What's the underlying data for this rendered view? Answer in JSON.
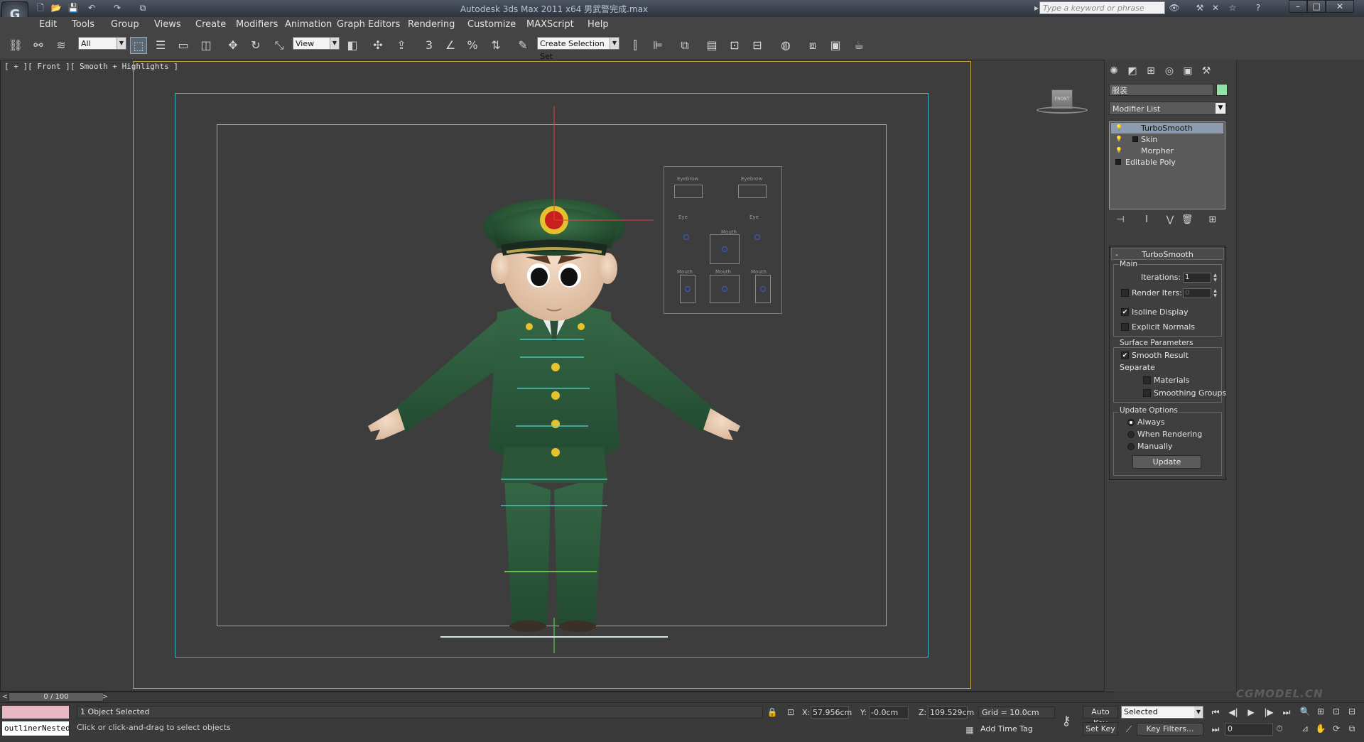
{
  "app": {
    "title": "Autodesk 3ds Max  2011 x64    男武警完成.max",
    "search_placeholder": "Type a keyword or phrase",
    "logo_label": "G",
    "window_buttons": [
      "–",
      "□",
      "✕"
    ]
  },
  "menu": [
    "Edit",
    "Tools",
    "Group",
    "Views",
    "Create",
    "Modifiers",
    "Animation",
    "Graph Editors",
    "Rendering",
    "Customize",
    "MAXScript",
    "Help"
  ],
  "toolbar": {
    "filter_value": "All",
    "refcoord_value": "View",
    "named_selection_placeholder": "Create Selection Set"
  },
  "viewport": {
    "label": "[ + ][ Front ][ Smooth + Highlights ]",
    "viewcube_label": "FRONT",
    "face_panel_labels": [
      "Eyebrow",
      "Eyebrow",
      "Eye",
      "Eye",
      "Mouth",
      "Mouth",
      "Mouth",
      "Mouth"
    ]
  },
  "command_panel": {
    "object_name": "服装",
    "modifier_list_label": "Modifier List",
    "stack": [
      {
        "label": "TurboSmooth",
        "selected": true
      },
      {
        "label": "Skin",
        "selected": false
      },
      {
        "label": "Morpher",
        "selected": false
      },
      {
        "label": "Editable Poly",
        "selected": false
      }
    ],
    "rollout": {
      "title": "TurboSmooth",
      "collapse_symbol": "-",
      "main_group": "Main",
      "iterations_label": "Iterations:",
      "iterations_value": "1",
      "render_iters_label": "Render Iters:",
      "render_iters_value": "0",
      "render_iters_checked": false,
      "isoline_label": "Isoline Display",
      "isoline_checked": true,
      "explicit_normals_label": "Explicit Normals",
      "explicit_normals_checked": false,
      "surface_group": "Surface Parameters",
      "smooth_result_label": "Smooth Result",
      "smooth_result_checked": true,
      "separate_label": "Separate",
      "materials_label": "Materials",
      "materials_checked": false,
      "smoothing_groups_label": "Smoothing Groups",
      "smoothing_groups_checked": false,
      "update_group": "Update Options",
      "update_options": [
        "Always",
        "When Rendering",
        "Manually"
      ],
      "update_selected": "Always",
      "update_button": "Update"
    }
  },
  "timeline": {
    "slider_label": "0 / 100"
  },
  "status": {
    "listener_text": "outlinerNested",
    "selection": "1 Object Selected",
    "prompt": "Click or click-and-drag to select objects",
    "x_label": "X:",
    "x_value": "57.956cm",
    "y_label": "Y:",
    "y_value": "-0.0cm",
    "z_label": "Z:",
    "z_value": "109.529cm",
    "grid": "Grid = 10.0cm",
    "add_time_tag": "Add Time Tag",
    "auto_key": "Auto Key",
    "set_key": "Set Key",
    "key_mode_value": "Selected",
    "key_filters": "Key Filters...",
    "current_frame": "0",
    "watermark": "CGMODEL.CN"
  },
  "colors": {
    "object_color": "#8fe3a8",
    "uniform": "#2f5a3a",
    "safe_frame_outer": "#c9a840",
    "safe_frame_cyan": "#3fb7c6",
    "selected_stack": "#8c9bb0"
  }
}
